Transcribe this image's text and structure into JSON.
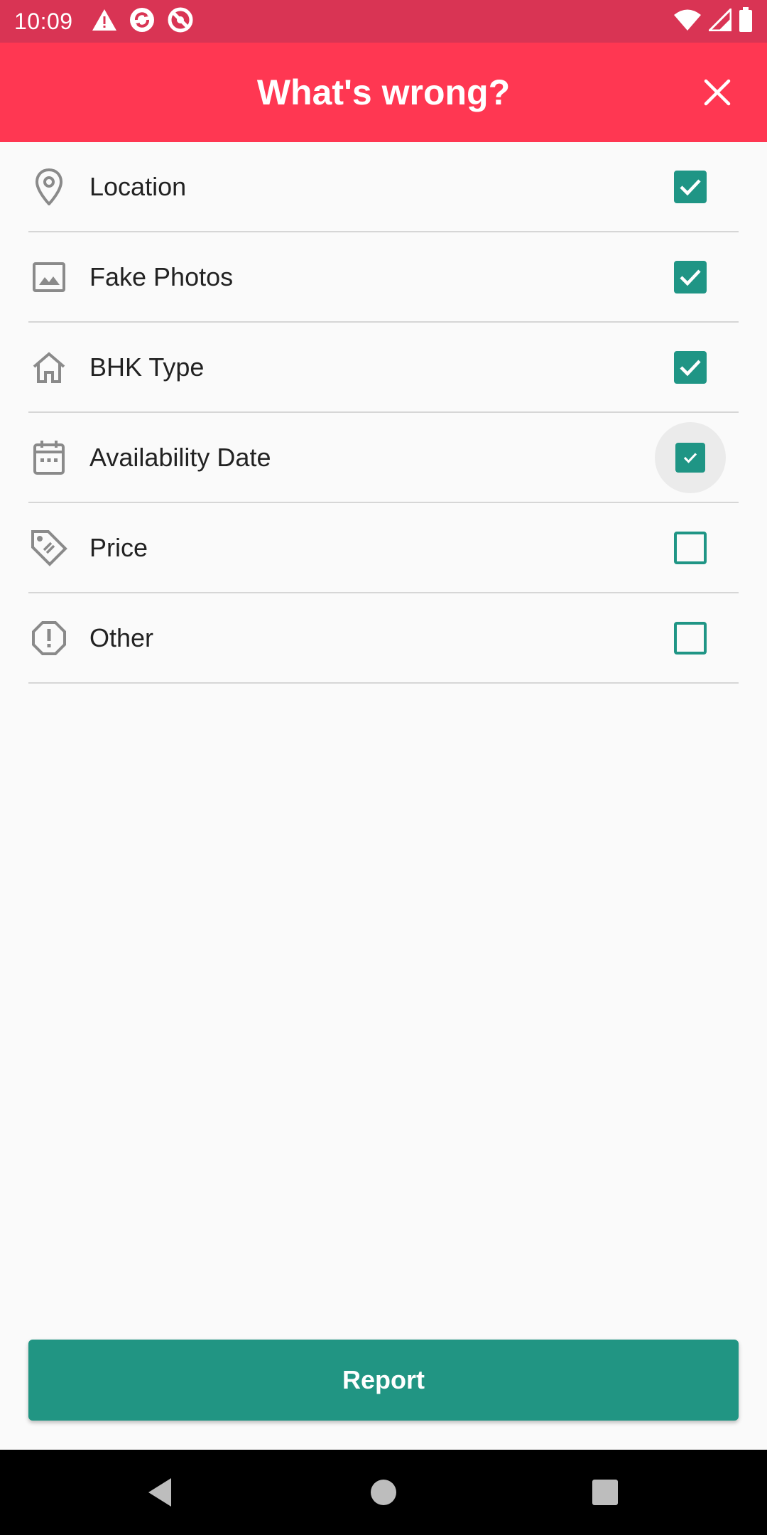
{
  "status_bar": {
    "time": "10:09",
    "left_icons": [
      "warning-icon",
      "sync-icon",
      "no-entry-icon"
    ],
    "right_icons": [
      "wifi-icon",
      "signal-icon",
      "battery-icon"
    ]
  },
  "app_bar": {
    "title": "What's wrong?",
    "close_icon": "close-icon"
  },
  "options": [
    {
      "label": "Location",
      "icon": "location-pin-icon",
      "checked": true
    },
    {
      "label": "Fake Photos",
      "icon": "image-icon",
      "checked": true
    },
    {
      "label": "BHK Type",
      "icon": "home-icon",
      "checked": true
    },
    {
      "label": "Availability Date",
      "icon": "calendar-icon",
      "checked": true
    },
    {
      "label": "Price",
      "icon": "price-tag-icon",
      "checked": false
    },
    {
      "label": "Other",
      "icon": "alert-octagon-icon",
      "checked": false
    }
  ],
  "report_button": {
    "label": "Report"
  },
  "colors": {
    "status_bar": "#d93454",
    "app_bar": "#ff3752",
    "accent": "#1f9585",
    "button": "#219583"
  },
  "nav_bar": {
    "icons": [
      "back-icon",
      "home-circle-icon",
      "recents-icon"
    ]
  }
}
